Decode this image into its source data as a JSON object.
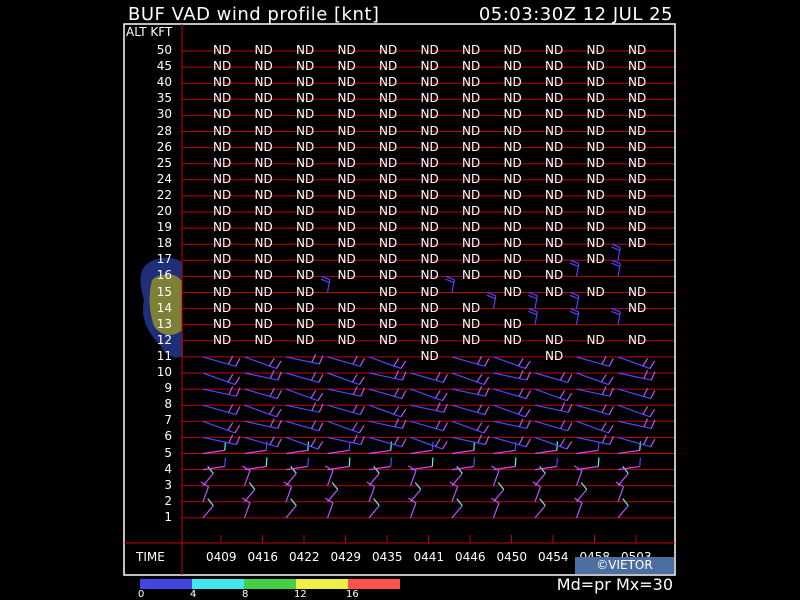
{
  "title": "BUF VAD wind profile [knt]",
  "timestamp": "05:03:30Z 12 JUL 25",
  "alt_header": "ALT KFT",
  "time_header": "TIME",
  "credit": "©VIETOR",
  "mode": "Md=pr Mx=30",
  "no_data_label": "ND",
  "colors": {
    "frame": "#ffffff",
    "grid": "#c80000",
    "barb_blue": "#4a4aff",
    "barb_purple": "#c050ff",
    "barb_cyan": "#50ffe0",
    "barb_green": "#50e050",
    "weather_echo_blue": "#203080",
    "weather_echo_olive": "#8a8a30"
  },
  "colorbar": {
    "colors": [
      "#4444e0",
      "#44e6f0",
      "#44d044",
      "#f0f044",
      "#ff5050"
    ],
    "ticks": [
      "0",
      "4",
      "8",
      "12",
      "16"
    ]
  },
  "chart_data": {
    "type": "wind_profile",
    "title": "BUF VAD wind profile [knt]",
    "ylabel": "ALT KFT",
    "xlabel": "TIME",
    "times": [
      "0409",
      "0416",
      "0422",
      "0429",
      "0435",
      "0441",
      "0446",
      "0450",
      "0454",
      "0458",
      "0503"
    ],
    "altitudes": [
      "50",
      "45",
      "40",
      "35",
      "30",
      "28",
      "26",
      "25",
      "24",
      "22",
      "20",
      "19",
      "18",
      "17",
      "16",
      "15",
      "14",
      "13",
      "12",
      "11",
      "10",
      "9",
      "8",
      "7",
      "6",
      "5",
      "4",
      "3",
      "2",
      "1"
    ],
    "nd_cells": {
      "50": [
        0,
        1,
        2,
        3,
        4,
        5,
        6,
        7,
        8,
        9,
        10
      ],
      "45": [
        0,
        1,
        2,
        3,
        4,
        5,
        6,
        7,
        8,
        9,
        10
      ],
      "40": [
        0,
        1,
        2,
        3,
        4,
        5,
        6,
        7,
        8,
        9,
        10
      ],
      "35": [
        0,
        1,
        2,
        3,
        4,
        5,
        6,
        7,
        8,
        9,
        10
      ],
      "30": [
        0,
        1,
        2,
        3,
        4,
        5,
        6,
        7,
        8,
        9,
        10
      ],
      "28": [
        0,
        1,
        2,
        3,
        4,
        5,
        6,
        7,
        8,
        9,
        10
      ],
      "26": [
        0,
        1,
        2,
        3,
        4,
        5,
        6,
        7,
        8,
        9,
        10
      ],
      "25": [
        0,
        1,
        2,
        3,
        4,
        5,
        6,
        7,
        8,
        9,
        10
      ],
      "24": [
        0,
        1,
        2,
        3,
        4,
        5,
        6,
        7,
        8,
        9,
        10
      ],
      "22": [
        0,
        1,
        2,
        3,
        4,
        5,
        6,
        7,
        8,
        9,
        10
      ],
      "20": [
        0,
        1,
        2,
        3,
        4,
        5,
        6,
        7,
        8,
        9,
        10
      ],
      "19": [
        0,
        1,
        2,
        3,
        4,
        5,
        6,
        7,
        8,
        9,
        10
      ],
      "18": [
        0,
        1,
        2,
        3,
        4,
        5,
        6,
        7,
        8,
        9,
        10
      ],
      "17": [
        0,
        1,
        2,
        3,
        4,
        5,
        6,
        7,
        8,
        9
      ],
      "16": [
        0,
        1,
        2,
        3,
        4,
        5,
        6,
        7,
        8
      ],
      "15": [
        0,
        1,
        2,
        4,
        5,
        7,
        8,
        9,
        10
      ],
      "14": [
        0,
        1,
        2,
        3,
        4,
        5,
        6,
        10
      ],
      "13": [
        0,
        1,
        2,
        3,
        4,
        5,
        6,
        7
      ],
      "12": [
        0,
        1,
        2,
        3,
        4,
        5,
        6,
        7,
        8,
        9,
        10
      ],
      "11": [
        5,
        8
      ]
    },
    "barb_cells": {
      "17": [
        10
      ],
      "16": [
        9,
        10
      ],
      "15": [
        3,
        6
      ],
      "14": [
        7,
        8,
        9
      ],
      "13": [
        8,
        9,
        10
      ],
      "11": [
        0,
        1,
        2,
        3,
        4,
        6,
        7,
        9,
        10
      ],
      "10": [
        0,
        1,
        2,
        3,
        4,
        5,
        6,
        7,
        8,
        9,
        10
      ],
      "9": [
        0,
        1,
        2,
        3,
        4,
        5,
        6,
        7,
        8,
        9,
        10
      ],
      "8": [
        0,
        1,
        2,
        3,
        4,
        5,
        6,
        7,
        8,
        9,
        10
      ],
      "7": [
        0,
        1,
        2,
        3,
        4,
        5,
        6,
        7,
        8,
        9,
        10
      ],
      "6": [
        0,
        1,
        2,
        3,
        4,
        5,
        6,
        7,
        8,
        9,
        10
      ],
      "5": [
        0,
        1,
        2,
        3,
        4,
        5,
        6,
        7,
        8,
        9,
        10
      ],
      "4": [
        0,
        1,
        2,
        3,
        4,
        5,
        6,
        7,
        8,
        9,
        10
      ],
      "3": [
        0,
        1,
        2,
        3,
        4,
        5,
        6,
        7,
        8,
        9,
        10
      ],
      "2": [
        0,
        1,
        2,
        3,
        4,
        5,
        6,
        7,
        8,
        9,
        10
      ],
      "1": [
        0,
        1,
        2,
        3,
        4,
        5,
        6,
        7,
        8,
        9,
        10
      ]
    },
    "wind_speed_units": "knt",
    "speed_colorbar_ticks": [
      0,
      4,
      8,
      12,
      16
    ]
  }
}
